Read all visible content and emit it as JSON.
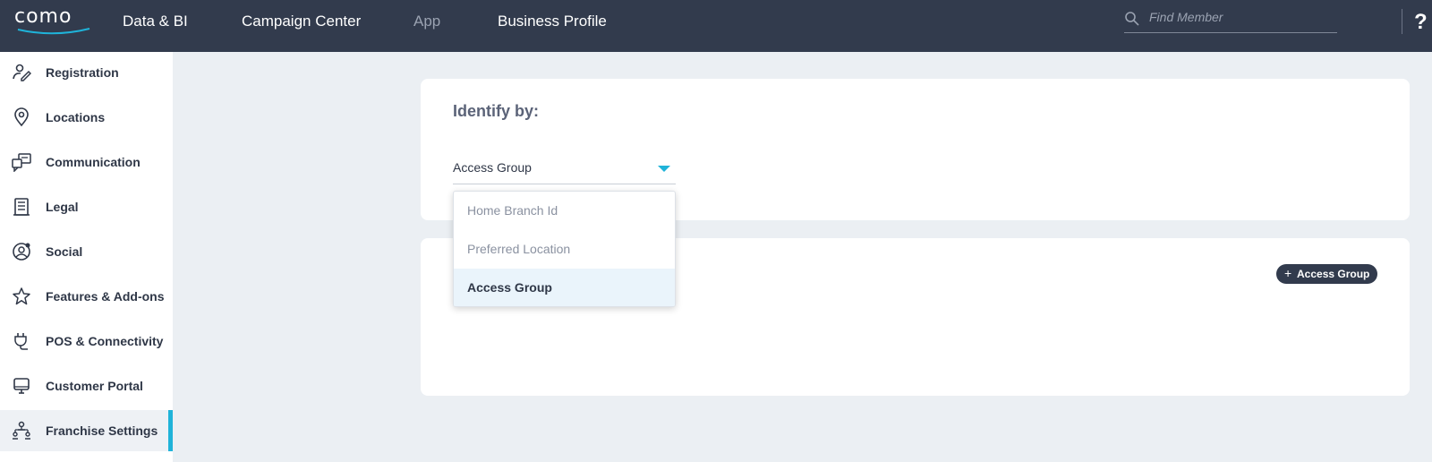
{
  "brand": {
    "logo_text": "como",
    "accent": "#1fb3d9",
    "topbar_bg": "#323b4d"
  },
  "nav": {
    "items": [
      {
        "label": "Data & BI"
      },
      {
        "label": "Campaign Center"
      },
      {
        "label": "App"
      },
      {
        "label": "Business Profile"
      }
    ],
    "search_placeholder": "Find Member",
    "help_label": "?"
  },
  "sidebar": {
    "items": [
      {
        "label": "Registration",
        "icon": "user-edit-icon"
      },
      {
        "label": "Locations",
        "icon": "location-pin-icon"
      },
      {
        "label": "Communication",
        "icon": "chat-icon"
      },
      {
        "label": "Legal",
        "icon": "document-icon"
      },
      {
        "label": "Social",
        "icon": "social-icon"
      },
      {
        "label": "Features & Add-ons",
        "icon": "star-icon"
      },
      {
        "label": "POS & Connectivity",
        "icon": "plug-icon"
      },
      {
        "label": "Customer Portal",
        "icon": "monitor-icon"
      },
      {
        "label": "Franchise Settings",
        "icon": "franchise-icon",
        "active": true
      }
    ]
  },
  "identify": {
    "title": "Identify by:",
    "selected_value": "Access Group",
    "options": [
      {
        "label": "Home Branch Id"
      },
      {
        "label": "Preferred Location"
      },
      {
        "label": "Access Group",
        "selected": true
      }
    ]
  },
  "access_group": {
    "add_button_label": "Access Group",
    "add_icon": "+"
  }
}
